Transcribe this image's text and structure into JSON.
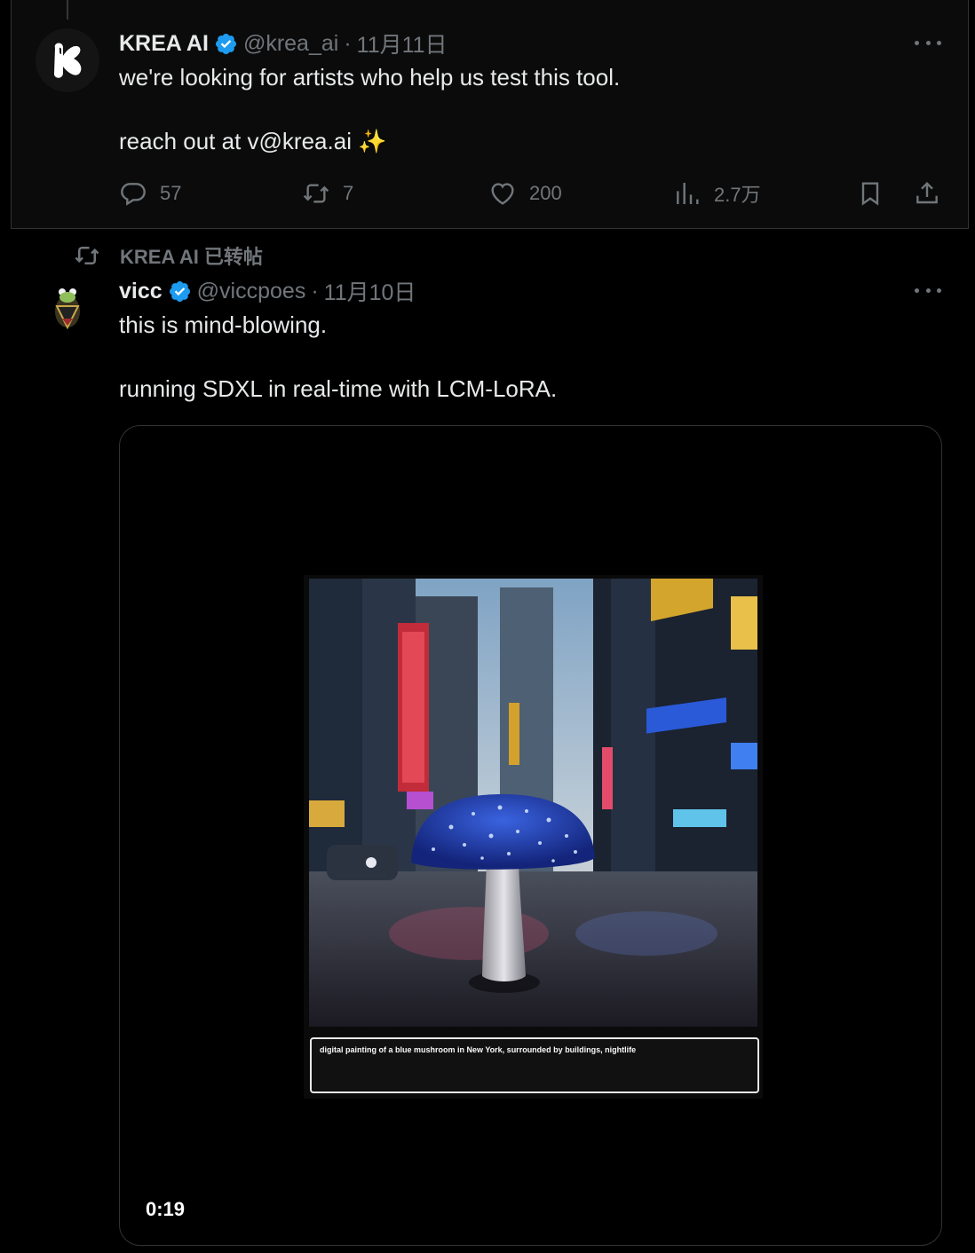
{
  "tweet1": {
    "author_name": "KREA AI",
    "handle": "@krea_ai",
    "date": "11月11日",
    "line1": "we're looking for artists who help us test this tool.",
    "line2": "reach out at v@krea.ai ✨",
    "replies": "57",
    "reposts": "7",
    "likes": "200",
    "views": "2.7万"
  },
  "repost_label": "KREA AI 已转帖",
  "tweet2": {
    "author_name": "vicc",
    "handle": "@viccpoes",
    "date": "11月10日",
    "line1": "this is mind-blowing.",
    "line2": "running SDXL in real-time with LCM-LoRA.",
    "video_prompt": "digital painting of a blue mushroom in New York, surrounded by buildings, nightlife",
    "video_duration": "0:19"
  },
  "colors": {
    "background": "#000000",
    "text": "#e7e9ea",
    "secondary": "#71767b",
    "verified": "#1d9bf0",
    "border": "#2f3336"
  }
}
